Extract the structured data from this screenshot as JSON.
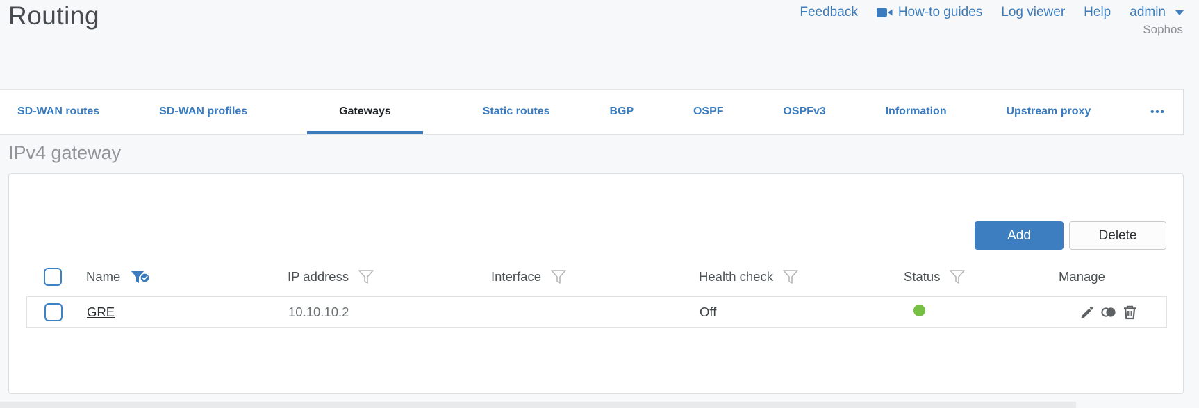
{
  "page": {
    "title": "Routing",
    "section_heading": "IPv4 gateway",
    "brand": "Sophos",
    "accent_color": "#3a7cbe",
    "status_green": "#76c044"
  },
  "header": {
    "feedback": "Feedback",
    "howto": "How-to guides",
    "log_viewer": "Log viewer",
    "help": "Help",
    "user": "admin"
  },
  "tabs": {
    "items": [
      {
        "label": "SD-WAN routes"
      },
      {
        "label": "SD-WAN profiles"
      },
      {
        "label": "Gateways"
      },
      {
        "label": "Static routes"
      },
      {
        "label": "BGP"
      },
      {
        "label": "OSPF"
      },
      {
        "label": "OSPFv3"
      },
      {
        "label": "Information"
      },
      {
        "label": "Upstream proxy"
      }
    ],
    "active_tab": "Gateways",
    "more": "•••"
  },
  "toolbar": {
    "add": "Add",
    "delete": "Delete"
  },
  "table": {
    "headers": {
      "name": "Name",
      "ip": "IP address",
      "interface": "Interface",
      "health": "Health check",
      "status": "Status",
      "manage": "Manage"
    },
    "name_filter_state": "active",
    "rows": [
      {
        "name": "GRE",
        "ip": "10.10.10.2",
        "interface": "",
        "health": "Off",
        "status": "green"
      }
    ]
  }
}
